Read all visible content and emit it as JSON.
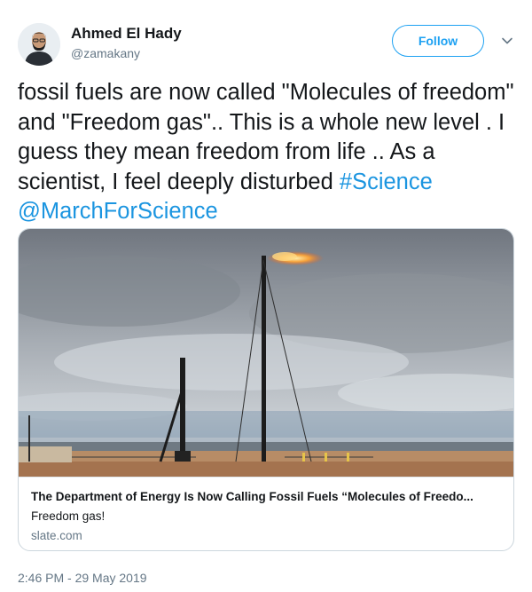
{
  "author": {
    "name": "Ahmed El Hady",
    "handle": "@zamakany",
    "follow_label": "Follow",
    "avatar_icon": "user-avatar"
  },
  "tweet": {
    "text": "fossil fuels are now called \"Molecules of freedom\" and \"Freedom gas\".. This is a whole new level . I guess they mean freedom from life .. As a scientist, I feel deeply disturbed ",
    "hashtag": "#Science",
    "mention": "@MarchForScience",
    "link_color": "#1b95e0"
  },
  "card": {
    "title": "The Department of Energy Is Now Calling Fossil Fuels “Molecules of Freedo...",
    "description": "Freedom gas!",
    "domain": "slate.com"
  },
  "timestamp": "2:46 PM - 29 May 2019",
  "colors": {
    "accent": "#1da1f2",
    "secondary_text": "#657786",
    "border": "#ccd6dd"
  }
}
